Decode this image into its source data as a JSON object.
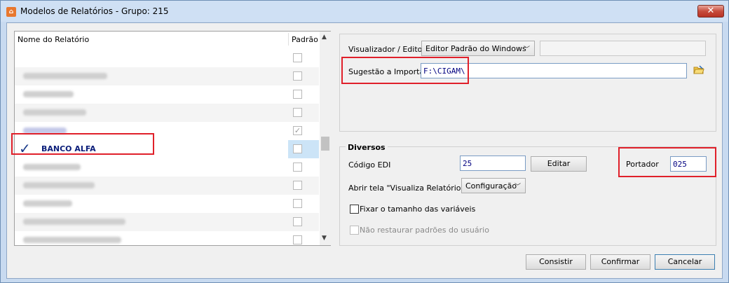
{
  "window": {
    "title": "Modelos de Relatórios - Grupo: 215",
    "close_glyph": "✕"
  },
  "list": {
    "col_name": "Nome do Relatório",
    "col_padrao": "Padrão",
    "selected_item": "BANCO ALFA",
    "selected_mark": "✓",
    "checked_glyph": "✓"
  },
  "viewer": {
    "label": "Visualizador / Editor",
    "value": "Editor Padrão do Windows"
  },
  "import": {
    "label": "Sugestão a Importar",
    "value": "F:\\CIGAM\\"
  },
  "diversos": {
    "title": "Diversos",
    "codigo_label": "Código EDI",
    "codigo_value": "25",
    "editar_label": "Editar",
    "portador_label": "Portador",
    "portador_value": "025",
    "abrir_label": "Abrir tela \"Visualiza Relatório\"",
    "abrir_value": "Configuração",
    "fixar_label": "Fixar o tamanho das variáveis",
    "restaurar_label": "Não restaurar padrões do usuário"
  },
  "buttons": {
    "consistir": "Consistir",
    "confirmar": "Confirmar",
    "cancelar": "Cancelar"
  },
  "colors": {
    "highlight": "#e0202a",
    "accent": "#0b1e7a"
  },
  "icons": {
    "app": "app-icon",
    "folder": "folder-open-icon"
  }
}
